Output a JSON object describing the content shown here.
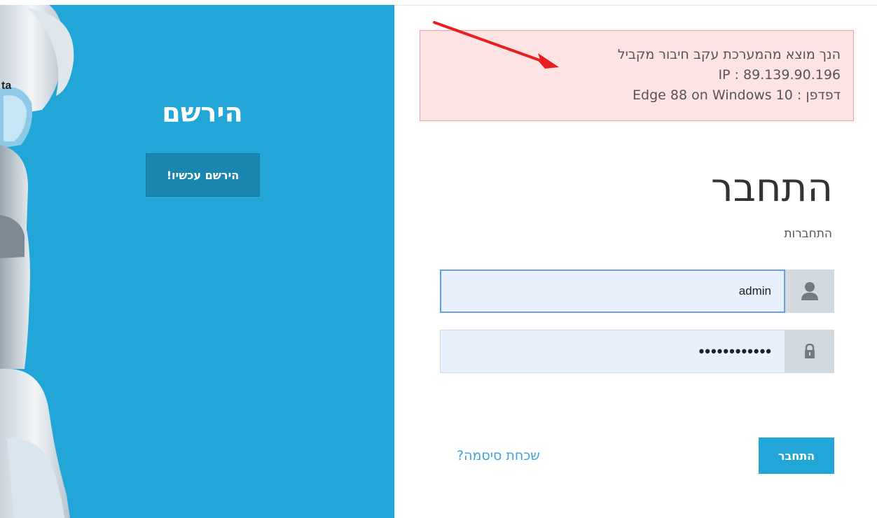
{
  "register": {
    "title": "הירשם",
    "button_label": "הירשם עכשיו!"
  },
  "alert": {
    "line1": "הנך מוצא מהמערכת עקב חיבור מקביל",
    "line2": "IP : 89.139.90.196",
    "line3": "דפדפן : Edge 88 on Windows 10"
  },
  "login": {
    "title": "התחבר",
    "subtitle": "התחברות",
    "username_value": "admin",
    "password_mask": "••••••••••••",
    "submit_label": "התחבר",
    "forgot_label": "שכחת סיסמה?"
  },
  "icons": {
    "user": "user-icon",
    "lock": "lock-icon",
    "arrow": "arrow-annotation"
  },
  "colors": {
    "brand_blue": "#22a6d8",
    "register_button": "#1a86b0",
    "alert_background": "#fde3e4",
    "alert_border": "#f3a1a6",
    "arrow_red": "#e81f1f",
    "input_background": "#e8f0fe",
    "addon_background": "#d3dadf"
  }
}
